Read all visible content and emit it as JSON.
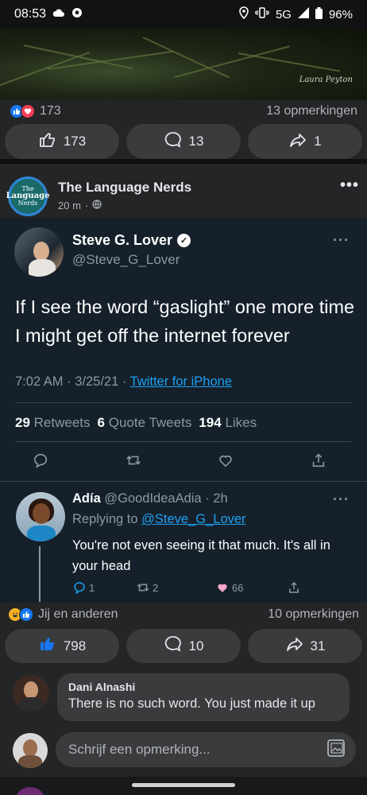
{
  "status_bar": {
    "time": "08:53",
    "network": "5G",
    "battery": "96%"
  },
  "prev_post": {
    "photo_credit": "Laura Peyton",
    "reaction_count": "173",
    "comments_label": "13 opmerkingen",
    "actions": {
      "like": "173",
      "comment": "13",
      "share": "1"
    }
  },
  "post": {
    "page_name": "The Language Nerds",
    "avatar_text_top": "The",
    "avatar_text_mid": "Language",
    "avatar_text_bot": "Nerds",
    "time": "20 m",
    "meta_sep": "·",
    "more": "•••"
  },
  "tweet": {
    "name": "Steve G. Lover",
    "handle": "@Steve_G_Lover",
    "text": "If I see the word “gaslight” one more time I might get off the internet forever",
    "timestamp": "7:02 AM · 3/25/21 · ",
    "client": "Twitter for iPhone",
    "stats": {
      "retweets_count": "29",
      "retweets_label": "Retweets",
      "quotes_count": "6",
      "quotes_label": "Quote Tweets",
      "likes_count": "194",
      "likes_label": "Likes"
    },
    "more": "···",
    "reply": {
      "name": "Adía",
      "handle_time": "@GoodIdeaAdia · 2h",
      "replying_prefix": "Replying to ",
      "replying_to": "@Steve_G_Lover",
      "text": "You're not even seeing it that much. It's all in your head",
      "replies": "1",
      "retweets": "2",
      "likes": "66",
      "more": "···"
    }
  },
  "post_footer": {
    "reactions_label": "Jij en anderen",
    "comments_label": "10 opmerkingen",
    "actions": {
      "like": "798",
      "comment": "10",
      "share": "31"
    }
  },
  "comment": {
    "author": "Dani Alnashi",
    "text": "There is no such word. You just made it up"
  },
  "composer": {
    "placeholder": "Schrijf een opmerking..."
  },
  "colors": {
    "facebook_blue": "#1877f2",
    "twitter_blue": "#1da1f2",
    "twitter_bg": "#15202b",
    "like_pink": "#f4a6c8"
  },
  "icons": [
    "cloud-icon",
    "soccer-ball-icon",
    "location-icon",
    "vibrate-icon",
    "signal-icon",
    "battery-icon",
    "like-icon",
    "love-icon",
    "haha-icon",
    "thumbs-up-icon",
    "comment-icon",
    "share-icon",
    "globe-icon",
    "verified-icon",
    "reply-icon",
    "retweet-icon",
    "heart-icon",
    "upload-icon",
    "photo-icon"
  ]
}
